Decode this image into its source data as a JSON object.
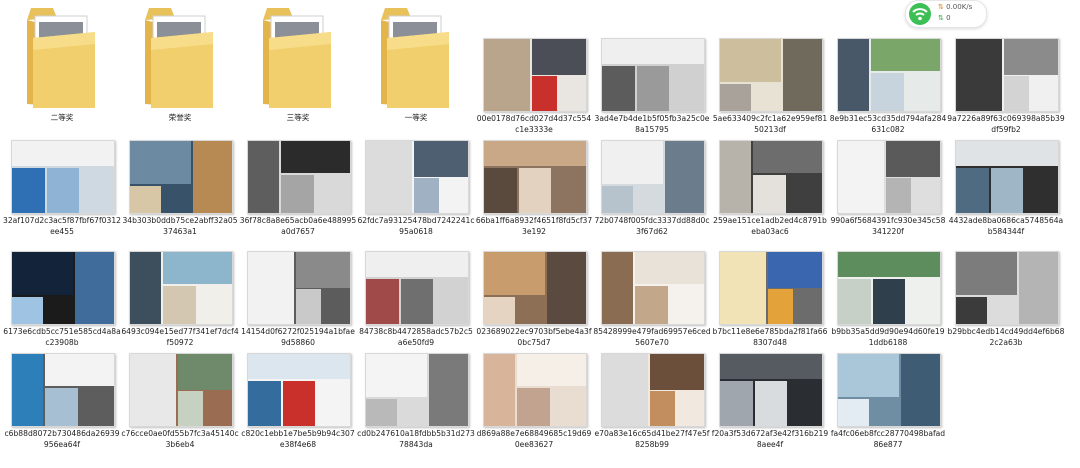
{
  "network": {
    "speed_text": "0.00K/s",
    "count_text": "0",
    "icon": "wifi-icon",
    "accent": "#3cbf55"
  },
  "folders": [
    {
      "label": "二等奖"
    },
    {
      "label": "荣誉奖"
    },
    {
      "label": "三等奖"
    },
    {
      "label": "一等奖"
    }
  ],
  "files": [
    {
      "label": "00e0178d76cd027d4d37c554c1e3333e",
      "palette": [
        "#b9a48c",
        "#4b4e57",
        "#c9302c",
        "#e9e6e1"
      ]
    },
    {
      "label": "3ad4e7b4de1b5f05fb3a25c0e8a15795",
      "palette": [
        "#efefef",
        "#5c5c5c",
        "#9a9a9a",
        "#d0d0d0"
      ]
    },
    {
      "label": "5ae633409c2fc1a62e959ef8150213df",
      "palette": [
        "#cdbf9d",
        "#6f6a5b",
        "#a9a29a",
        "#e8e2d4"
      ]
    },
    {
      "label": "8e9b31ec53cd35dd794afa284631c082",
      "palette": [
        "#7aa66a",
        "#485868",
        "#c7d3dd",
        "#e6ebe9"
      ]
    },
    {
      "label": "9a7226a89f63c069398a85b39df59fb2",
      "palette": [
        "#3a3a3a",
        "#8b8b8b",
        "#d3d3d3",
        "#f0f0f0"
      ]
    },
    {
      "label": "32af107d2c3ac5f87fbf67f0312ee455",
      "palette": [
        "#f2f2f2",
        "#2f6fb3",
        "#8eb3d4",
        "#cfd9e2"
      ]
    },
    {
      "label": "34b303b0ddb75ce2abff32a0537463a1",
      "palette": [
        "#6c8aa1",
        "#b68a52",
        "#d7c7a6",
        "#38526a"
      ]
    },
    {
      "label": "36f78c8a8e65acb0a6e488995a0d7657",
      "palette": [
        "#2b2b2b",
        "#5e5e5e",
        "#a5a5a5",
        "#d9d9d9"
      ]
    },
    {
      "label": "62fdc7a93125478bd7242241c95a0618",
      "palette": [
        "#dcdcdc",
        "#4d5f70",
        "#9fb1c2",
        "#f3f3f3"
      ]
    },
    {
      "label": "66ba1ff6a8932f4651f8fd5cf373e192",
      "palette": [
        "#c9a888",
        "#5a4a3e",
        "#e3d2c0",
        "#8c7460"
      ]
    },
    {
      "label": "72b0748f005fdc3337dd88d0c3f67d62",
      "palette": [
        "#f0f0f0",
        "#6b7d8d",
        "#b6c2cc",
        "#d5dade"
      ]
    },
    {
      "label": "259ae151ce1adb2ed4c8791beba03ac6",
      "palette": [
        "#6d6d6d",
        "#b7b2aa",
        "#e4e1dc",
        "#3f3f3f"
      ]
    },
    {
      "label": "990a6f5684391fc930e345c58341220f",
      "palette": [
        "#f3f3f3",
        "#5a5a5a",
        "#b4b4b4",
        "#dedede"
      ]
    },
    {
      "label": "4432ade8ba0686ca5748564ab584344f",
      "palette": [
        "#dfe3e6",
        "#4f6b82",
        "#9eb6c6",
        "#2f2f2f"
      ]
    },
    {
      "label": "6173e6cdb5cc751e585cd4a8ac23908b",
      "palette": [
        "#12233a",
        "#3f6c9b",
        "#9fc3e3",
        "#1b1b1b"
      ]
    },
    {
      "label": "6493c094e15ed77f341ef7dcf4f50972",
      "palette": [
        "#8db6cc",
        "#3d4e5c",
        "#d4c7b2",
        "#f1efe9"
      ]
    },
    {
      "label": "14154d0f6272f025194a1bfae9d58860",
      "palette": [
        "#f2f2f2",
        "#8a8a8a",
        "#c9c9c9",
        "#5c5c5c"
      ]
    },
    {
      "label": "84738c8b4472858adc57b2c5a6e50fd9",
      "palette": [
        "#efefef",
        "#a04a4a",
        "#6f6f6f",
        "#d2d2d2"
      ]
    },
    {
      "label": "023689022ec9703bf5ebe4a3f0bc75d7",
      "palette": [
        "#c99c6e",
        "#5b4a3f",
        "#e6d4c2",
        "#8c6f55"
      ]
    },
    {
      "label": "85428999e479fad69957e6ced5607e70",
      "palette": [
        "#e9e2d8",
        "#8a6c53",
        "#c2a78b",
        "#f5f1ec"
      ]
    },
    {
      "label": "b7bc11e8e6e785bda2f81fa668307d48",
      "palette": [
        "#f1e3b6",
        "#3a66b0",
        "#e3a33a",
        "#6c6c6c"
      ]
    },
    {
      "label": "b9bb35a5dd9d90e94d60fe191ddb6188",
      "palette": [
        "#5d8c5d",
        "#c7d0c6",
        "#2f3f4c",
        "#eef0ee"
      ]
    },
    {
      "label": "b29bbc4edb14cd49dd4ef6b682c2a63b",
      "palette": [
        "#7c7c7c",
        "#b4b4b4",
        "#3b3b3b",
        "#dcdcdc"
      ]
    },
    {
      "label": "c6b88d8072b730486da26939956ea64f",
      "palette": [
        "#f3f3f3",
        "#2c7fb8",
        "#a6bfd3",
        "#5d5d5d"
      ]
    },
    {
      "label": "c76cce0ae0fd55b7fc3a45140c3b6eb4",
      "palette": [
        "#e8e8e8",
        "#6f8a6a",
        "#c6d1c2",
        "#9a6d52"
      ]
    },
    {
      "label": "c820c1ebb1e7be5b9b94c307e38f4e68",
      "palette": [
        "#dce6ef",
        "#356c9e",
        "#c9302c",
        "#f4f4f4"
      ]
    },
    {
      "label": "cd0b247610a18fdbb5b31d27378843da",
      "palette": [
        "#f4f4f4",
        "#7a7a7a",
        "#b9b9b9",
        "#dadada"
      ]
    },
    {
      "label": "d869a88e7e68849685c19d690ee83627",
      "palette": [
        "#f6efe8",
        "#d8b49a",
        "#c2a390",
        "#e9dcd1"
      ]
    },
    {
      "label": "e70a83e16c65d41be27f47e5f8258b99",
      "palette": [
        "#dcdcdc",
        "#6b4f3b",
        "#c28d5f",
        "#f1e9e0"
      ]
    },
    {
      "label": "f20a3f53d672af3e42f316b2198aee4f",
      "palette": [
        "#565b62",
        "#a0a6ad",
        "#d9dcdf",
        "#2a2d31"
      ]
    },
    {
      "label": "fa4fc06eb8fcc28770498bafad86e877",
      "palette": [
        "#a9c7d9",
        "#3e5c73",
        "#e2ecf2",
        "#6f8ea3"
      ]
    }
  ]
}
